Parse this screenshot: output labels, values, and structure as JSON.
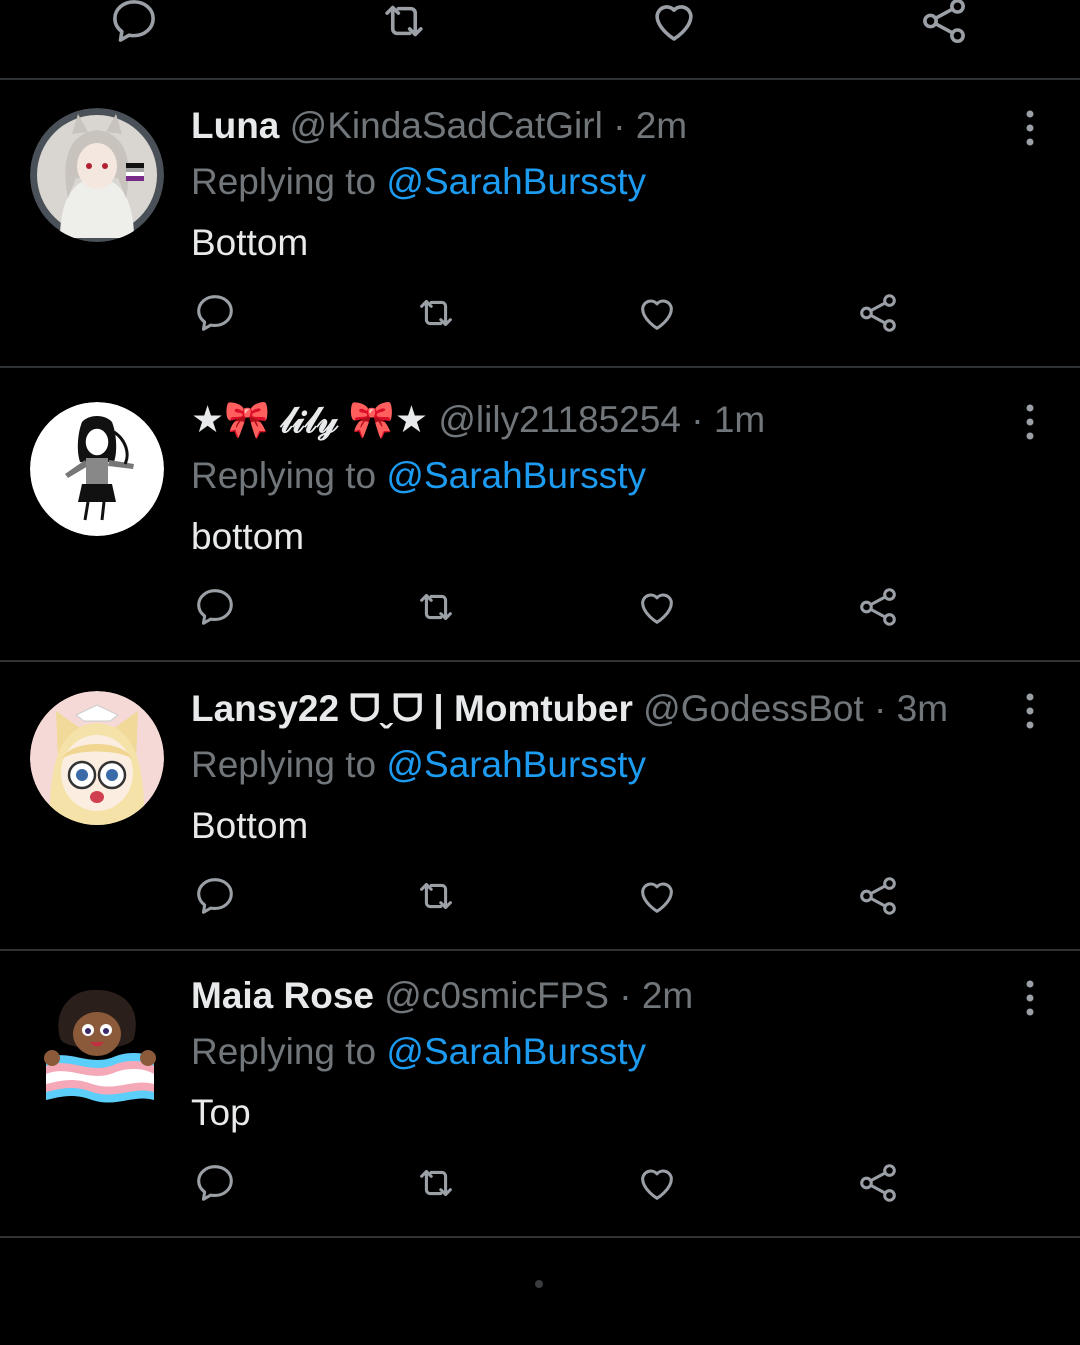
{
  "theme": {
    "background": "#000000",
    "primary_text": "#e7e9ea",
    "secondary_text": "#71767b",
    "accent": "#1d9bf0",
    "divider": "#2f3336"
  },
  "top_actions": [
    {
      "icon": "reply-icon"
    },
    {
      "icon": "retweet-icon"
    },
    {
      "icon": "like-icon"
    },
    {
      "icon": "share-icon"
    }
  ],
  "replies": [
    {
      "name": "Luna",
      "handle": "@KindaSadCatGirl",
      "separator": "·",
      "time": "2m",
      "replying_prefix": "Replying to",
      "replying_to": "@SarahBurssty",
      "text": "Bottom",
      "avatar_desc": "anime cat girl with white hair"
    },
    {
      "name": "★🎀 𝓁𝒾𝓁𝓎 🎀★",
      "handle": "@lily21185254",
      "separator": "·",
      "time": "1m",
      "replying_prefix": "Replying to",
      "replying_to": "@SarahBurssty",
      "text": "bottom",
      "avatar_desc": "black and white drawing of a girl"
    },
    {
      "name": "Lansy22 ᗜˬᗜ | Momtuber",
      "handle": "@GodessBot",
      "separator": "·",
      "time": "3m",
      "replying_prefix": "Replying to",
      "replying_to": "@SarahBurssty",
      "text": "Bottom",
      "avatar_desc": "blonde anime fox girl with glasses"
    },
    {
      "name": "Maia Rose",
      "handle": "@c0smicFPS",
      "separator": "·",
      "time": "2m",
      "replying_prefix": "Replying to",
      "replying_to": "@SarahBurssty",
      "text": "Top",
      "avatar_desc": "cartoon character holding trans flag"
    }
  ]
}
